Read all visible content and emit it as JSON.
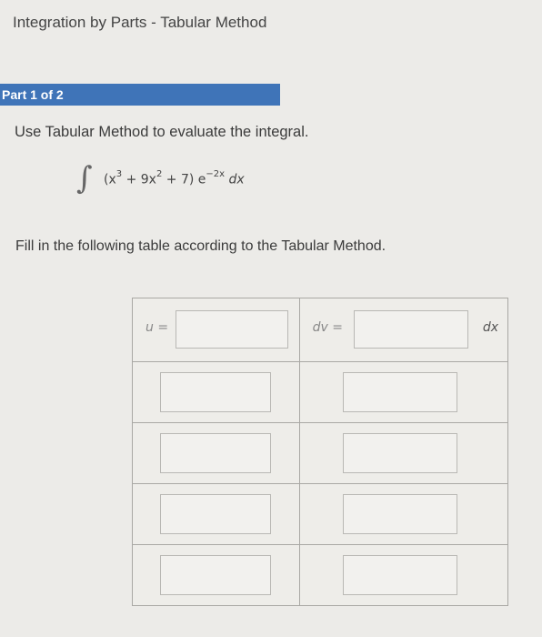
{
  "header": {
    "title": "Integration by Parts - Tabular Method"
  },
  "part": {
    "label": "Part 1 of 2"
  },
  "question": {
    "instruction": "Use Tabular Method to evaluate the integral.",
    "integral": {
      "sign": "∫",
      "open": "(x",
      "exp1": "3",
      "mid1": " + 9x",
      "exp2": "2",
      "mid2": " + 7) e",
      "exp3": "−2x",
      "tail": " dx"
    },
    "fill_instruction": "Fill in the following table according to the Tabular Method."
  },
  "table": {
    "u_label": "u =",
    "dv_label": "dv =",
    "dx_label": "dx",
    "inputs": {
      "u": "",
      "dv": "",
      "u_rows": [
        "",
        "",
        "",
        ""
      ],
      "dv_rows": [
        "",
        "",
        "",
        ""
      ]
    }
  },
  "colors": {
    "part_bar": "#3f74b8",
    "background": "#ecebe8"
  }
}
